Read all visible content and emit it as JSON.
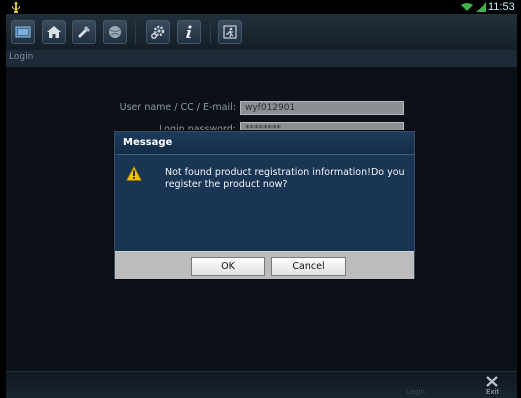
{
  "status_bar": {
    "time": "11:53 AM",
    "icons": [
      "usb-icon",
      "wifi-icon",
      "signal-icon"
    ]
  },
  "toolbar": {
    "buttons": [
      "app-icon",
      "home-icon",
      "diagnostic-icon",
      "globe-icon",
      "settings-icon",
      "info-icon",
      "exit-icon"
    ]
  },
  "page": {
    "title": "Login"
  },
  "form": {
    "username_label": "User name / CC / E-mail:",
    "username_value": "wyf012901",
    "password_label": "Login password:",
    "password_value": "********"
  },
  "dialog": {
    "title": "Message",
    "icon": "warning-icon",
    "message": "Not found product registration information!Do you register the product now?",
    "ok_label": "OK",
    "cancel_label": "Cancel"
  },
  "bottom_bar": {
    "login_label": "Login",
    "exit_label": "Exit"
  },
  "colors": {
    "dialog_bg": "#1a3554",
    "footer_bg": "#bcbcbc",
    "warning": "#f2c200"
  }
}
